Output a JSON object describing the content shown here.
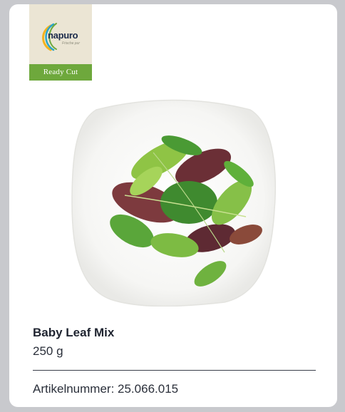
{
  "brand": {
    "wordmark": "napuro",
    "tagline": "Frische pur",
    "ribbon": "Ready Cut"
  },
  "product": {
    "name": "Baby Leaf Mix",
    "weight": "250 g",
    "article_number": "Artikelnummer: 25.066.015"
  },
  "colors": {
    "page_background": "#c8c9cd",
    "card": "#ffffff",
    "ribbon_green": "#6ea83c",
    "text": "#1f2430"
  }
}
